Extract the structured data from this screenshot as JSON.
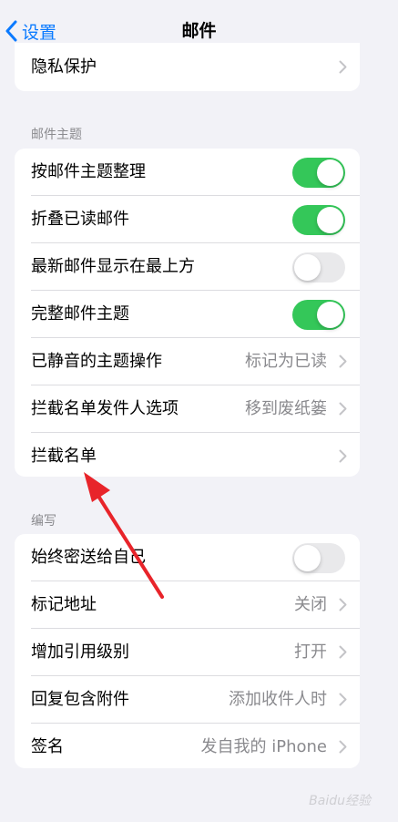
{
  "nav": {
    "back_label": "设置",
    "title": "邮件"
  },
  "privacy": {
    "label": "隐私保护"
  },
  "threading": {
    "header": "邮件主题",
    "rows": [
      {
        "label": "按邮件主题整理",
        "toggle": true
      },
      {
        "label": "折叠已读邮件",
        "toggle": true
      },
      {
        "label": "最新邮件显示在最上方",
        "toggle": false
      },
      {
        "label": "完整邮件主题",
        "toggle": true
      },
      {
        "label": "已静音的主题操作",
        "value": "标记为已读"
      },
      {
        "label": "拦截名单发件人选项",
        "value": "移到废纸篓"
      },
      {
        "label": "拦截名单"
      }
    ]
  },
  "composing": {
    "header": "编写",
    "rows": [
      {
        "label": "始终密送给自己",
        "toggle": false
      },
      {
        "label": "标记地址",
        "value": "关闭"
      },
      {
        "label": "增加引用级别",
        "value": "打开"
      },
      {
        "label": "回复包含附件",
        "value": "添加收件人时"
      },
      {
        "label": "签名",
        "value": "发自我的 iPhone"
      }
    ]
  },
  "colors": {
    "accent": "#0a7aff",
    "toggle_on": "#34c759",
    "annotation_arrow": "#e8242a"
  },
  "watermark": {
    "text": "Baidu经验"
  }
}
